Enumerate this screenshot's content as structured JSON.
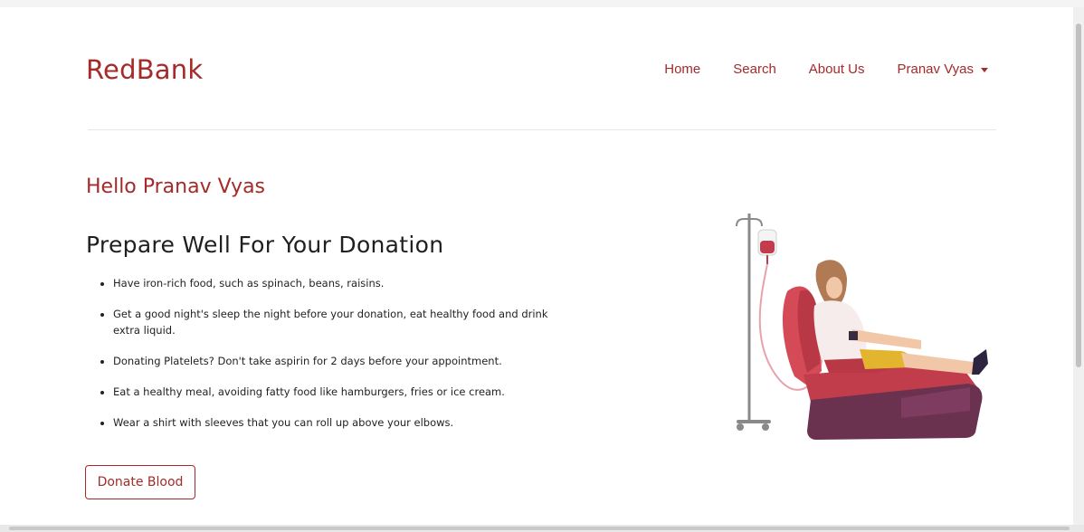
{
  "brand": "RedBank",
  "nav": {
    "home": "Home",
    "search": "Search",
    "about": "About Us",
    "user": "Pranav Vyas"
  },
  "greeting": "Hello Pranav Vyas",
  "section_title": "Prepare Well For Your Donation",
  "tips": [
    "Have iron-rich food, such as spinach, beans, raisins.",
    "Get a good night's sleep the night before your donation, eat healthy food and drink extra liquid.",
    "Donating Platelets? Don't take aspirin for 2 days before your appointment.",
    "Eat a healthy meal, avoiding fatty food like hamburgers, fries or ice cream.",
    "Wear a shirt with sleeves that you can roll up above your elbows."
  ],
  "donate_button": "Donate Blood",
  "colors": {
    "brand": "#a52a2a",
    "text": "#1f1f1f",
    "divider": "#e6e6e6"
  },
  "icons": {
    "dropdown": "caret-down-icon",
    "illustration": "blood-donation-illustration"
  }
}
